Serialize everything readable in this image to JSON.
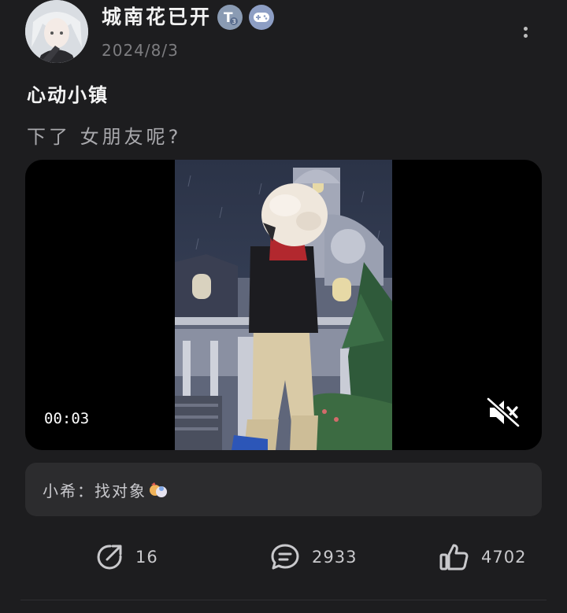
{
  "post": {
    "author": "城南花已开",
    "date": "2024/8/3",
    "title": "心动小镇",
    "body": "下了 女朋友呢?",
    "badges": [
      "T3-level-badge",
      "gamepad-badge"
    ]
  },
  "video": {
    "timestamp": "00:03",
    "muted": true
  },
  "comment": {
    "author": "小希",
    "separator": "：",
    "text": "找对象"
  },
  "actions": {
    "share_count": "16",
    "comment_count": "2933",
    "like_count": "4702"
  },
  "colors": {
    "background": "#1d1d1f",
    "card": "#2c2c2e",
    "secondary_text": "#7d7d80"
  }
}
